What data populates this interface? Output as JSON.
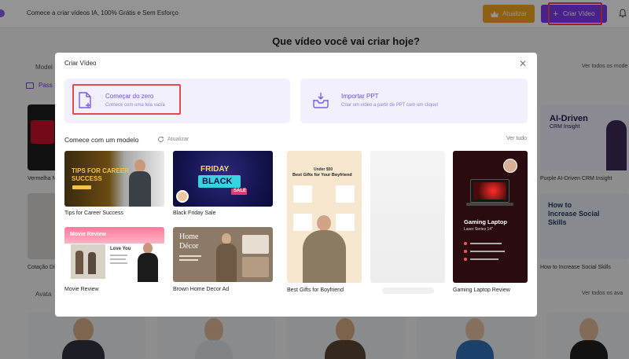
{
  "topbar": {
    "tagline": "Comece a criar vídeos IA, 100% Grátis e Sem Esforço",
    "upgrade_label": "Atualizar",
    "create_label": "Criar Vídeo"
  },
  "hero": {
    "title": "Que vídeo você vai criar hoje?"
  },
  "background": {
    "models_head": "Model",
    "see_all_models": "Ver todos os mode",
    "tab_label": "Pass",
    "left_captions": [
      "Vermelha N",
      "Cotação Di"
    ],
    "right_captions": [
      "Purple AI-Driven CRM Insight",
      "How to Increase Social Skills"
    ],
    "avatars_head": "Avata",
    "see_all_avatars": "Ver todos os ava",
    "right_card_1_text": [
      "AI-Driven",
      "CRM Insight"
    ],
    "right_card_2_text": [
      "How to",
      "Increase Social",
      "Skills"
    ]
  },
  "modal": {
    "title": "Criar Vídeo",
    "options": [
      {
        "title": "Começar do zero",
        "subtitle": "Comece com uma tela vazia"
      },
      {
        "title": "Importar PPT",
        "subtitle": "Criar um vídeo a partir de PPT com um clique!"
      }
    ],
    "section_title": "Comece com um modelo",
    "refresh_label": "Atualizar",
    "see_all": "Ver tudo",
    "templates": [
      {
        "caption": "Tips for Career Success",
        "art": [
          "TIPS FOR CAREER",
          "SUCCESS"
        ]
      },
      {
        "caption": "Black Friday Sale",
        "art": [
          "FRIDAY",
          "BLACK",
          "SALE"
        ]
      },
      {
        "caption": "Movie Review",
        "art": [
          "Movie Review",
          "Love You"
        ]
      },
      {
        "caption": "Brown Home Decor Ad",
        "art": [
          "Home",
          "Décor"
        ]
      },
      {
        "caption": "Best Gifts for Boyfriend",
        "art": [
          "Under $50",
          "Best Gifts for Your Boyfriend"
        ]
      },
      {
        "caption": "",
        "art": []
      },
      {
        "caption": "Gaming Laptop Review",
        "art": [
          "Gaming Laptop",
          "Laser Series 14\""
        ]
      }
    ]
  },
  "colors": {
    "accent": "#7c3aed",
    "upgrade": "#f5a623",
    "highlight": "#e5484d",
    "option_bg": "#f3f0fe"
  }
}
